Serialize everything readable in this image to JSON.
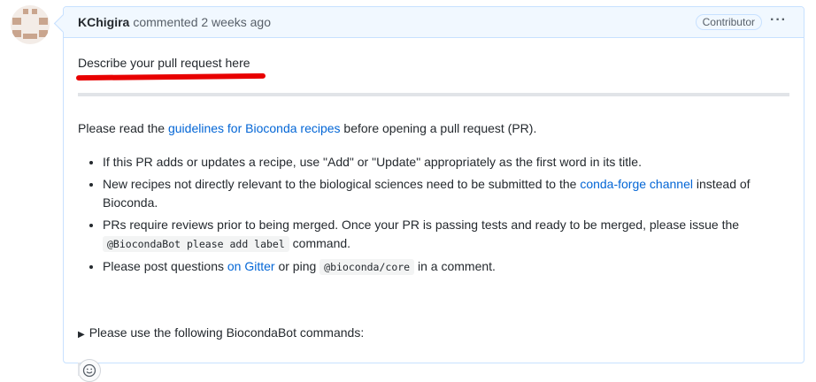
{
  "comment": {
    "author": "KChigira",
    "action": "commented 2 weeks ago",
    "badge": "Contributor",
    "more_icon": "kebab-horizontal-icon",
    "describe": "Describe your pull request here",
    "para_before": "Please read the ",
    "para_link": "guidelines for Bioconda recipes",
    "para_after": " before opening a pull request (PR).",
    "bullets": {
      "b1": "If this PR adds or updates a recipe, use \"Add\" or \"Update\" appropriately as the first word in its title.",
      "b2_before": "New recipes not directly relevant to the biological sciences need to be submitted to the ",
      "b2_link": "conda-forge channel",
      "b2_after": " instead of Bioconda.",
      "b3_before": "PRs require reviews prior to being merged. Once your PR is passing tests and ready to be merged, please issue the ",
      "b3_code": "@BiocondaBot please add label",
      "b3_after": " command.",
      "b4_before": "Please post questions ",
      "b4_link": "on Gitter",
      "b4_mid": " or ping ",
      "b4_code": "@bioconda/core",
      "b4_after": " in a comment."
    },
    "details_summary": "Please use the following BiocondaBot commands:",
    "emoji_icon": "smiley-icon"
  },
  "colors": {
    "link": "#0366d6",
    "header_bg": "#f1f8ff",
    "border": "#c8e1ff",
    "annotation": "#e80000"
  }
}
